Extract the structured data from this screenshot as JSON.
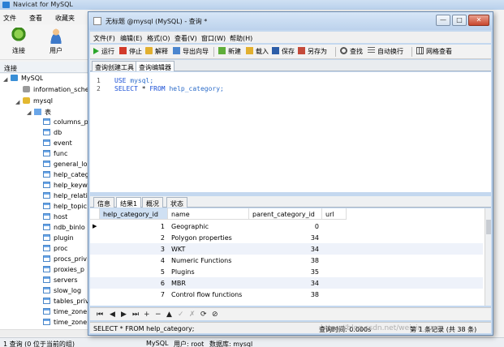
{
  "main_window": {
    "title": "Navicat for MySQL",
    "menu": [
      "文件",
      "查看",
      "收藏夹"
    ],
    "toolbar": [
      {
        "label": "连接",
        "icon": "connection-icon"
      },
      {
        "label": "用户",
        "icon": "user-icon"
      }
    ],
    "connection_label": "连接",
    "tree": {
      "root": "MySQL",
      "databases": [
        "information_sche",
        "mysql"
      ],
      "tables_folder": "表",
      "tables": [
        "columns_p",
        "db",
        "event",
        "func",
        "general_lo",
        "help_categ",
        "help_keyw",
        "help_relati",
        "help_topic",
        "host",
        "ndb_binlo",
        "plugin",
        "proc",
        "procs_priv",
        "proxies_p",
        "servers",
        "slow_log",
        "tables_priv",
        "time_zone",
        "time_zone"
      ]
    },
    "status": {
      "left": "1 查询 (0 位于当前的组)",
      "connection": "MySQL",
      "user": "用户: root",
      "database": "数据库: mysql"
    }
  },
  "query_window": {
    "title": "无标题 @mysql (MySQL) - 查询 *",
    "window_buttons": [
      "—",
      "□",
      "✕"
    ],
    "menu": [
      "文件(F)",
      "编辑(E)",
      "格式(O)",
      "查看(V)",
      "窗口(W)",
      "帮助(H)"
    ],
    "toolbar": [
      {
        "label": "运行",
        "icon": "run-icon"
      },
      {
        "label": "停止",
        "icon": "stop-icon"
      },
      {
        "label": "解释",
        "icon": "explain-icon"
      },
      {
        "label": "导出向导",
        "icon": "export-wizard-icon"
      },
      {
        "label": "新建",
        "icon": "new-icon"
      },
      {
        "label": "载入",
        "icon": "load-icon"
      },
      {
        "label": "保存",
        "icon": "save-icon"
      },
      {
        "label": "另存为",
        "icon": "save-as-icon"
      },
      {
        "label": "查找",
        "icon": "find-icon"
      },
      {
        "label": "自动换行",
        "icon": "word-wrap-icon"
      },
      {
        "label": "网格查看",
        "icon": "grid-view-icon"
      }
    ],
    "editor_tabs": [
      "查询创建工具",
      "查询编辑器"
    ],
    "code_lines": [
      {
        "num": "1",
        "kw1": "USE",
        "rest": " mysql;"
      },
      {
        "num": "2",
        "kw1": "SELECT",
        "mid": " * ",
        "kw2": "FROM",
        "rest": " help_category;"
      }
    ],
    "result_tabs": [
      "信息",
      "结果1",
      "概况",
      "状态"
    ],
    "grid": {
      "columns": [
        "help_category_id",
        "name",
        "parent_category_id",
        "url"
      ],
      "rows": [
        {
          "id": "1",
          "name": "Geographic",
          "parent": "0",
          "url": ""
        },
        {
          "id": "2",
          "name": "Polygon properties",
          "parent": "34",
          "url": ""
        },
        {
          "id": "3",
          "name": "WKT",
          "parent": "34",
          "url": ""
        },
        {
          "id": "4",
          "name": "Numeric Functions",
          "parent": "38",
          "url": ""
        },
        {
          "id": "5",
          "name": "Plugins",
          "parent": "35",
          "url": ""
        },
        {
          "id": "6",
          "name": "MBR",
          "parent": "34",
          "url": ""
        },
        {
          "id": "7",
          "name": "Control flow functions",
          "parent": "38",
          "url": ""
        }
      ]
    },
    "nav_buttons": [
      "⏮",
      "◀",
      "▶",
      "⏭",
      "+",
      "−",
      "▲",
      "✓",
      "✗",
      "⟳",
      "⊘"
    ],
    "status": {
      "sql": "SELECT * FROM help_category;",
      "time": "查询时间: 0.000s",
      "record": "第 1 条记录 (共 38 条)"
    }
  },
  "watermark": "https://blog.csdn.net/weixin_xxxx"
}
